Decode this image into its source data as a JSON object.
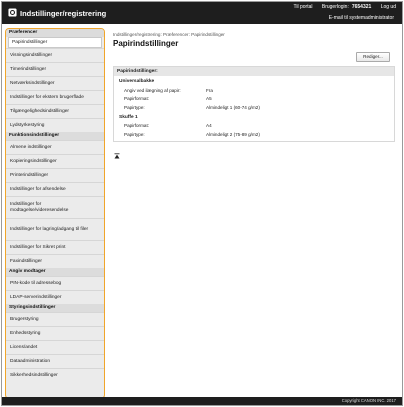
{
  "header": {
    "title": "Indstillinger/registrering",
    "top_links": {
      "portal": "Til portal",
      "login_label": "Brugerlogin:",
      "user_id": "7654321",
      "logout": "Log ud"
    },
    "email_link": "E-mail til systemadministrator",
    "accent": "#f0a52a"
  },
  "sidebar": {
    "sections": [
      {
        "title": "Præferencer",
        "items": [
          "Papirindstillinger",
          "Visningsindstillinger",
          "Timerindstillinger",
          "Netværksindstillinger",
          "Indstillinger for ekstern brugerflade",
          "Tilgængelighedsindstillinger",
          "Lydstyrkestyring"
        ]
      },
      {
        "title": "Funktionsindstillinger",
        "items": [
          "Almene indstillinger",
          "Kopieringsindstillinger",
          "Printerindstillinger",
          "Indstillinger for afsendelse",
          "Indstillinger for modtagelse/videresendelse",
          "Indstillinger for lagring/adgang til filer",
          "Indstillinger for Sikret print",
          "Faxindstillinger"
        ]
      },
      {
        "title": "Angiv modtager",
        "items": [
          "PIN-kode til adressebog",
          "LDAP-serverindstillinger"
        ]
      },
      {
        "title": "Styringsindstillinger",
        "items": [
          "Brugerstyring",
          "Enhedsstyring",
          "Licens/andet",
          "Dataadministration",
          "Sikkerhedsindstillinger"
        ]
      }
    ]
  },
  "main": {
    "breadcrumb": "Indstillinger/registrering: Præferencer: Papirindstillinger",
    "title": "Papirindstillinger",
    "edit_button": "Rediger...",
    "panel_title": "Papirindstillinger:",
    "groups": [
      {
        "title": "Universalbakke",
        "rows": [
          {
            "key": "Angiv ved ilægning af papir:",
            "value": "Fra"
          },
          {
            "key": "Papirformat:",
            "value": "A5"
          },
          {
            "key": "Papirtype:",
            "value": "Almindeligt 1 (60-74 g/m2)"
          }
        ]
      },
      {
        "title": "Skuffe 1",
        "rows": [
          {
            "key": "Papirformat:",
            "value": "A4"
          },
          {
            "key": "Papirtype:",
            "value": "Almindeligt 2 (75-89 g/m2)"
          }
        ]
      }
    ],
    "back_to_top_icon": "arrow-up-to-top"
  },
  "footer": {
    "copyright": "Copyright CANON INC. 2017"
  }
}
